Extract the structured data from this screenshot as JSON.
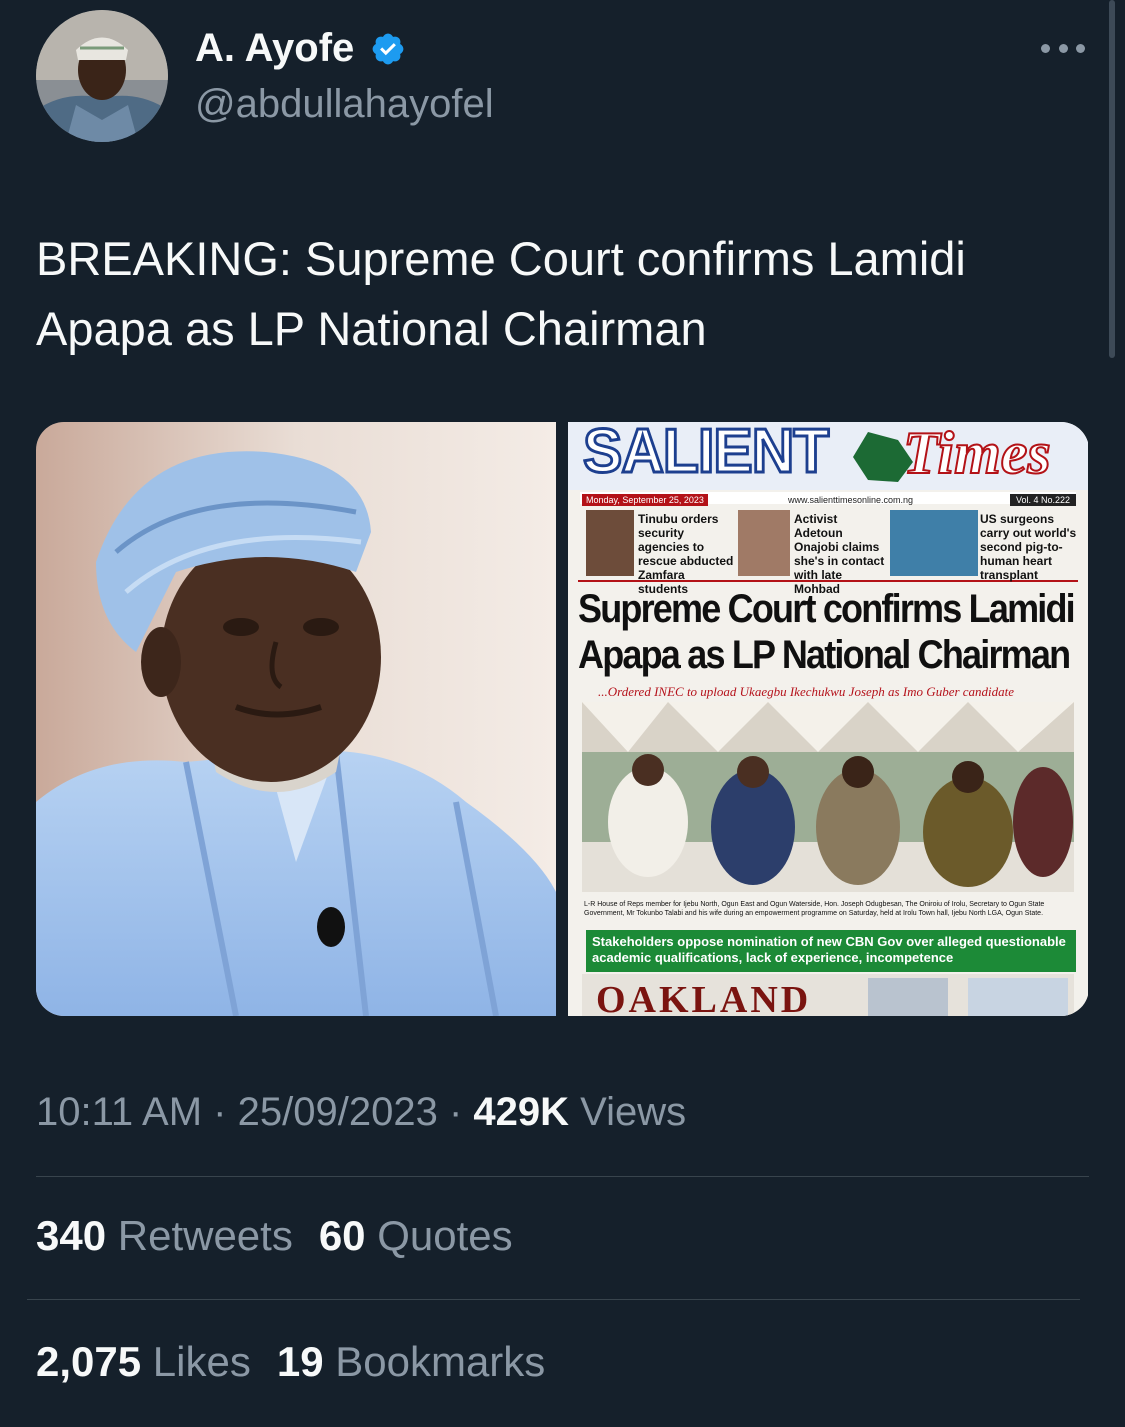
{
  "author": {
    "name": "A. Ayofe",
    "handle": "@abdullahayofel",
    "verified": true,
    "verified_color": "#1d9bf0"
  },
  "tweet": {
    "text": "BREAKING: Supreme Court confirms Lamidi Apapa as LP National Chairman"
  },
  "newspaper": {
    "masthead_left": "SALIENT",
    "masthead_right": "Times",
    "date": "Monday, September 25, 2023",
    "url": "www.salienttimesonline.com.ng",
    "volume": "Vol. 4    No.222",
    "briefs": [
      "Tinubu orders security agencies to rescue abducted Zamfara students",
      "Activist Adetoun Onajobi claims she's in contact with late Mohbad",
      "US surgeons carry out world's second pig-to-human heart transplant"
    ],
    "headline_line1": "Supreme Court confirms Lamidi",
    "headline_line2": "Apapa as LP National Chairman",
    "subheadline": "...Ordered INEC to upload Ukaegbu Ikechukwu Joseph as Imo Guber candidate",
    "caption": "L-R House of Reps member for Ijebu North, Ogun East and Ogun Waterside, Hon. Joseph Odugbesan, The Oniroiu of Irolu, Secretary to Ogun State Government, Mr Tokunbo Talabi and his wife during an empowerment programme on Saturday, held at Irolu Town hall, Ijebu North LGA, Ogun State.",
    "green_banner": "Stakeholders oppose nomination of new CBN Gov over alleged questionable academic qualifications, lack of experience, incompetence",
    "ad_text": "OAKLAND"
  },
  "meta": {
    "time": "10:11 AM",
    "separator": "·",
    "date": "25/09/2023",
    "views_count": "429K",
    "views_label": "Views"
  },
  "stats": {
    "retweets_count": "340",
    "retweets_label": "Retweets",
    "quotes_count": "60",
    "quotes_label": "Quotes",
    "likes_count": "2,075",
    "likes_label": "Likes",
    "bookmarks_count": "19",
    "bookmarks_label": "Bookmarks"
  },
  "colors": {
    "background": "#15202b",
    "text_primary": "#f7f9f9",
    "text_secondary": "#8b98a5",
    "divider": "#38444d"
  }
}
